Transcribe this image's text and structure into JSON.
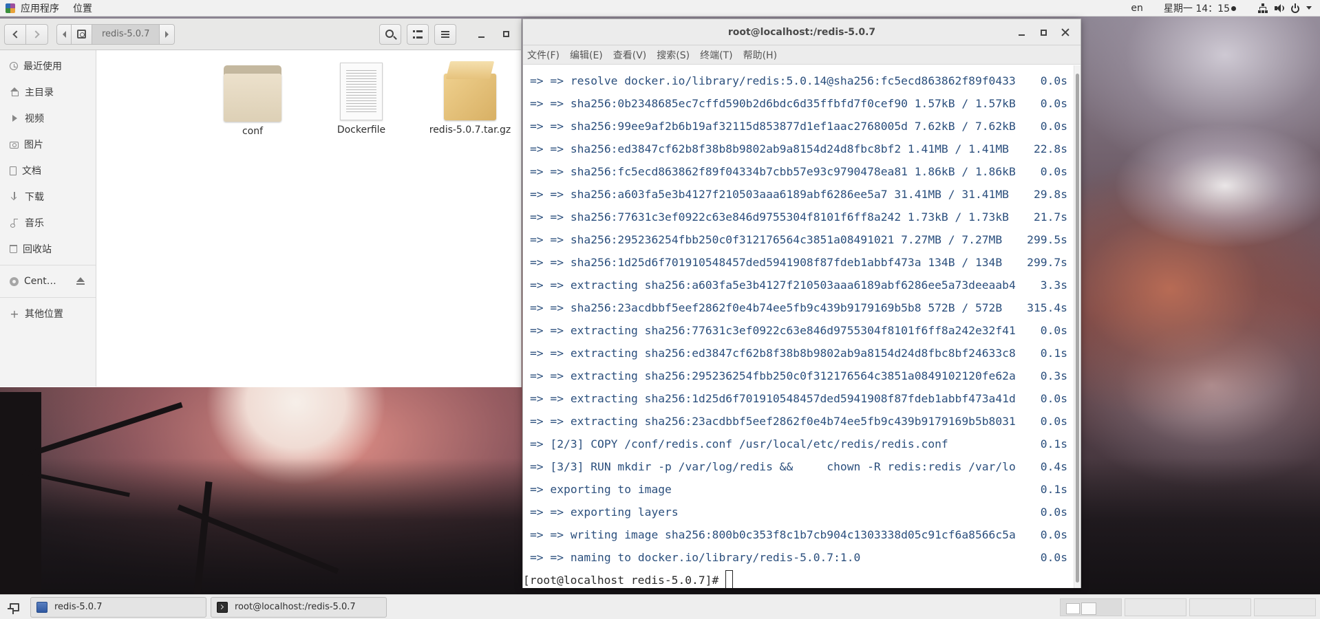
{
  "topbar": {
    "applications": "应用程序",
    "places": "位置",
    "language": "en",
    "datetime": "星期一 14：15"
  },
  "file_manager": {
    "path_current": "redis-5.0.7",
    "sidebar": [
      {
        "label": "最近使用",
        "icon": "clock-icon"
      },
      {
        "label": "主目录",
        "icon": "home-icon"
      },
      {
        "label": "视频",
        "icon": "video-icon"
      },
      {
        "label": "图片",
        "icon": "camera-icon"
      },
      {
        "label": "文档",
        "icon": "document-icon"
      },
      {
        "label": "下载",
        "icon": "download-icon"
      },
      {
        "label": "音乐",
        "icon": "music-icon"
      },
      {
        "label": "回收站",
        "icon": "trash-icon"
      }
    ],
    "device": {
      "label": "Cent…",
      "icon": "disc-icon"
    },
    "other_locations": "其他位置",
    "files": [
      {
        "name": "conf",
        "type": "folder"
      },
      {
        "name": "Dockerfile",
        "type": "text"
      },
      {
        "name": "redis-5.0.7.tar.gz",
        "type": "archive"
      }
    ]
  },
  "terminal": {
    "title": "root@localhost:/redis-5.0.7",
    "menu": [
      "文件(F)",
      "编辑(E)",
      "查看(V)",
      "搜索(S)",
      "终端(T)",
      "帮助(H)"
    ],
    "lines": [
      {
        "text": "=> => resolve docker.io/library/redis:5.0.14@sha256:fc5ecd863862f89f0433",
        "time": "0.0s"
      },
      {
        "text": "=> => sha256:0b2348685ec7cffd590b2d6bdc6d35ffbfd7f0cef90 1.57kB / 1.57kB",
        "time": "0.0s"
      },
      {
        "text": "=> => sha256:99ee9af2b6b19af32115d853877d1ef1aac2768005d 7.62kB / 7.62kB",
        "time": "0.0s"
      },
      {
        "text": "=> => sha256:ed3847cf62b8f38b8b9802ab9a8154d24d8fbc8bf2 1.41MB / 1.41MB",
        "time": "22.8s"
      },
      {
        "text": "=> => sha256:fc5ecd863862f89f04334b7cbb57e93c9790478ea81 1.86kB / 1.86kB",
        "time": "0.0s"
      },
      {
        "text": "=> => sha256:a603fa5e3b4127f210503aaa6189abf6286ee5a7 31.41MB / 31.41MB",
        "time": "29.8s"
      },
      {
        "text": "=> => sha256:77631c3ef0922c63e846d9755304f8101f6ff8a242 1.73kB / 1.73kB",
        "time": "21.7s"
      },
      {
        "text": "=> => sha256:295236254fbb250c0f312176564c3851a08491021 7.27MB / 7.27MB",
        "time": "299.5s"
      },
      {
        "text": "=> => sha256:1d25d6f701910548457ded5941908f87fdeb1abbf473a 134B / 134B",
        "time": "299.7s"
      },
      {
        "text": "=> => extracting sha256:a603fa5e3b4127f210503aaa6189abf6286ee5a73deeaab4",
        "time": "3.3s"
      },
      {
        "text": "=> => sha256:23acdbbf5eef2862f0e4b74ee5fb9c439b9179169b5b8 572B / 572B",
        "time": "315.4s"
      },
      {
        "text": "=> => extracting sha256:77631c3ef0922c63e846d9755304f8101f6ff8a242e32f41",
        "time": "0.0s"
      },
      {
        "text": "=> => extracting sha256:ed3847cf62b8f38b8b9802ab9a8154d24d8fbc8bf24633c8",
        "time": "0.1s"
      },
      {
        "text": "=> => extracting sha256:295236254fbb250c0f312176564c3851a0849102120fe62a",
        "time": "0.3s"
      },
      {
        "text": "=> => extracting sha256:1d25d6f701910548457ded5941908f87fdeb1abbf473a41d",
        "time": "0.0s"
      },
      {
        "text": "=> => extracting sha256:23acdbbf5eef2862f0e4b74ee5fb9c439b9179169b5b8031",
        "time": "0.0s"
      },
      {
        "text": "=> [2/3] COPY /conf/redis.conf /usr/local/etc/redis/redis.conf",
        "time": "0.1s"
      },
      {
        "text": "=> [3/3] RUN mkdir -p /var/log/redis &&     chown -R redis:redis /var/lo",
        "time": "0.4s"
      },
      {
        "text": "=> exporting to image",
        "time": "0.1s"
      },
      {
        "text": "=> => exporting layers",
        "time": "0.0s"
      },
      {
        "text": "=> => writing image sha256:800b0c353f8c1b7cb904c1303338d05c91cf6a8566c5a",
        "time": "0.0s"
      },
      {
        "text": "=> => naming to docker.io/library/redis-5.0.7:1.0",
        "time": "0.0s"
      }
    ],
    "prompt": "[root@localhost redis-5.0.7]#"
  },
  "taskbar": {
    "tasks": [
      {
        "label": "redis-5.0.7",
        "icon": "file-manager-icon"
      },
      {
        "label": "root@localhost:/redis-5.0.7",
        "icon": "terminal-icon"
      }
    ]
  }
}
